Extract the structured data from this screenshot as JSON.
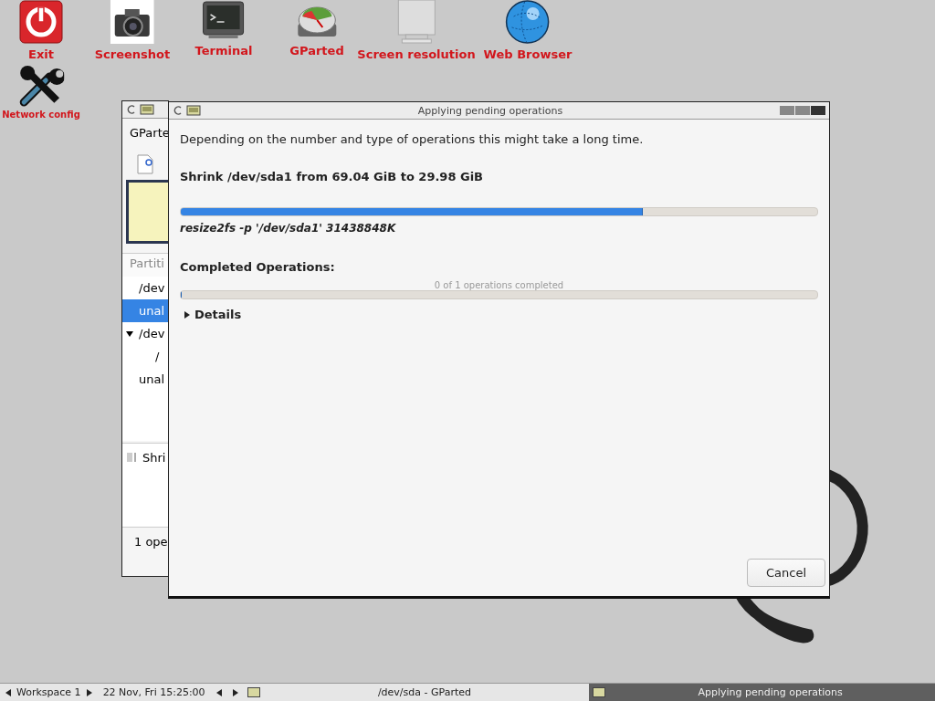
{
  "desktop_icons": [
    {
      "kind": "exit",
      "label": "Exit"
    },
    {
      "kind": "camera",
      "label": "Screenshot"
    },
    {
      "kind": "terminal",
      "label": "Terminal"
    },
    {
      "kind": "disk",
      "label": "GParted"
    },
    {
      "kind": "monitor",
      "label": "Screen resolution"
    },
    {
      "kind": "globe",
      "label": "Web Browser"
    },
    {
      "kind": "tools",
      "label": "Network config"
    }
  ],
  "background_window": {
    "title": "GParte",
    "partitions_header": "Partiti",
    "partitions": [
      {
        "text": "/dev",
        "selected": false
      },
      {
        "text": "unal",
        "selected": true
      },
      {
        "text": "/dev",
        "selected": false,
        "expanded": true,
        "children": [
          {
            "text": "/",
            "selected": false
          }
        ]
      },
      {
        "text": "unal",
        "selected": false
      }
    ],
    "pending_operation": "Shri",
    "status_bar": "1 ope"
  },
  "dialog": {
    "title": "Applying pending operations",
    "description": "Depending on the number and type of operations this might take a long time.",
    "operation": "Shrink /dev/sda1 from 69.04 GiB to 29.98 GiB",
    "progress": {
      "level": 0.725
    },
    "command": "resize2fs -p '/dev/sda1' 31438848K",
    "completed_label": "Completed Operations:",
    "completed_progress": {
      "text": "0 of 1 operations completed",
      "level": 0
    },
    "details": {
      "label": "Details",
      "expanded": false
    },
    "buttons": [
      "Cancel"
    ]
  },
  "taskbar": {
    "workspace": "Workspace 1",
    "clock": "22 Nov, Fri 15:25:00",
    "tasks": [
      {
        "label": "/dev/sda - GParted",
        "selected": false
      },
      {
        "label": "Applying pending operations",
        "selected": true
      }
    ]
  }
}
